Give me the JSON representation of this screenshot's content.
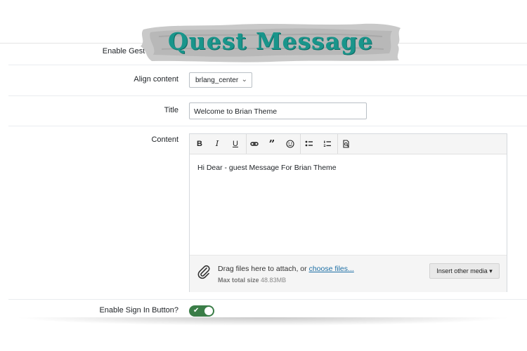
{
  "banner": {
    "title": "Quest Message"
  },
  "form": {
    "enable_guest_label": "Enable Gest Message",
    "align_label": "Align content",
    "align_value": "brlang_center",
    "title_label": "Title",
    "title_value": "Welcome to Brian Theme",
    "content_label": "Content",
    "signin_label": "Enable Sign In Button?"
  },
  "editor": {
    "toolbar": {
      "bold": "B",
      "italic": "I",
      "underline": "U",
      "quote": "”"
    },
    "content": "Hi Dear - guest Message For Brian Theme",
    "drag_text": "Drag files here to attach, or",
    "choose_files": "choose files...",
    "max_label": "Max total size",
    "max_value": "48.83MB",
    "insert_media": "Insert other media ▾"
  },
  "colors": {
    "toggle_on": "#3a7d47",
    "banner": "#19958b",
    "link": "#1d6fa5"
  }
}
